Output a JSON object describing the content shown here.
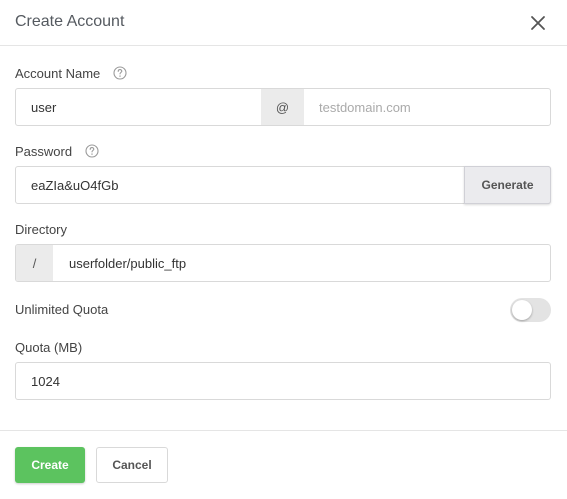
{
  "dialog": {
    "title": "Create Account",
    "close_icon": "close-icon"
  },
  "account_name": {
    "label": "Account Name",
    "value": "user",
    "at_symbol": "@",
    "domain_placeholder": "testdomain.com",
    "help_icon": "question-circle-icon"
  },
  "password": {
    "label": "Password",
    "value": "eaZIa&uO4fGb",
    "generate_label": "Generate",
    "help_icon": "question-circle-icon"
  },
  "directory": {
    "label": "Directory",
    "prefix": "/",
    "value": "userfolder/public_ftp"
  },
  "unlimited_quota": {
    "label": "Unlimited Quota",
    "enabled": false
  },
  "quota": {
    "label": "Quota (MB)",
    "value": "1024"
  },
  "footer": {
    "create_label": "Create",
    "cancel_label": "Cancel"
  },
  "colors": {
    "primary_button": "#5cc35f",
    "addon_background": "#ebebeb",
    "toggle_off": "#e3e3e3"
  }
}
